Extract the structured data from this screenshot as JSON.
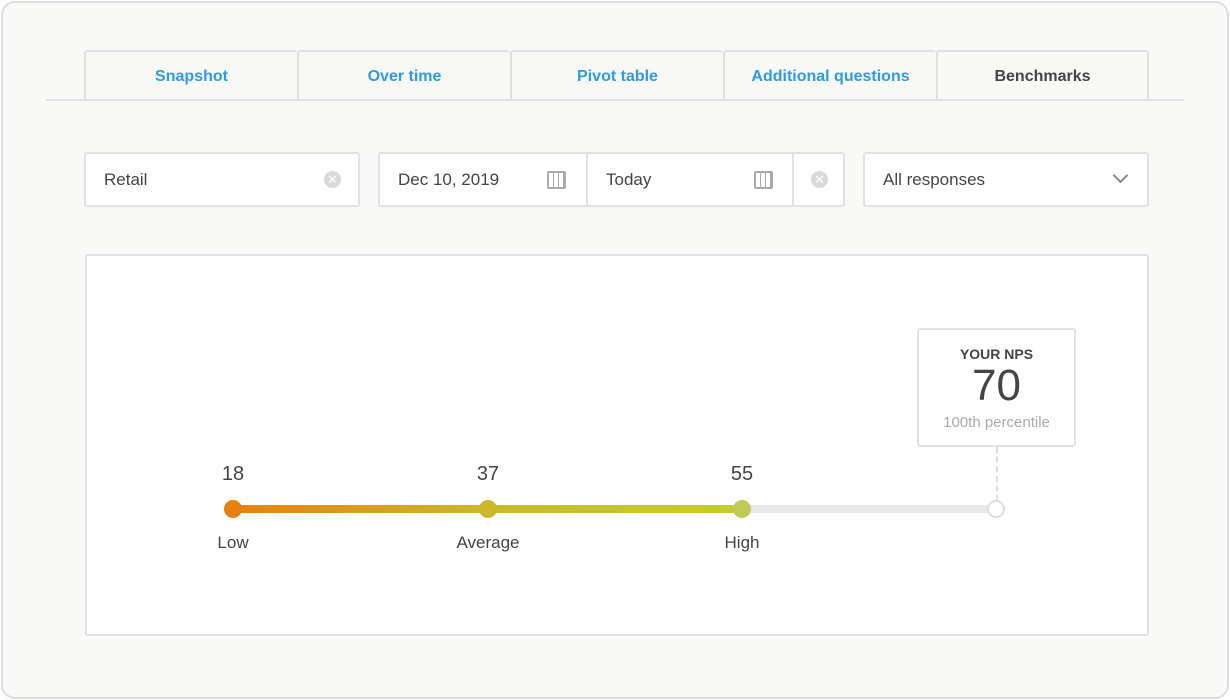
{
  "tabs": [
    {
      "label": "Snapshot"
    },
    {
      "label": "Over time"
    },
    {
      "label": "Pivot table"
    },
    {
      "label": "Additional questions"
    },
    {
      "label": "Benchmarks",
      "active": true
    }
  ],
  "filters": {
    "industry": "Retail",
    "start_date": "Dec 10, 2019",
    "end_date": "Today",
    "responses": "All responses"
  },
  "benchmark": {
    "points": [
      {
        "label": "Low",
        "value": 18,
        "color": "#e5820e"
      },
      {
        "label": "Average",
        "value": 37,
        "color": "#cbb82a"
      },
      {
        "label": "High",
        "value": 55,
        "color": "#c3c957"
      }
    ],
    "your_nps": {
      "title": "YOUR NPS",
      "value": 70,
      "percentile": "100th percentile"
    }
  },
  "colors": {
    "accent": "#2d9be6",
    "low": "#e5820e",
    "high": "#c3c957"
  }
}
